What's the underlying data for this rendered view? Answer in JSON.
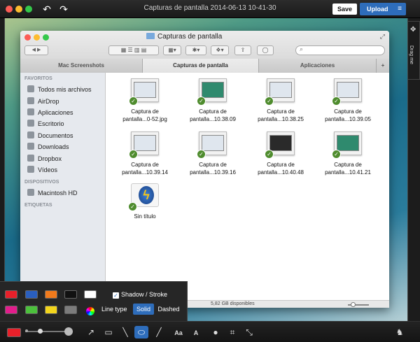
{
  "topbar": {
    "title": "Capturas de pantalla 2014-06-13 10-41-30",
    "save_label": "Save",
    "upload_label": "Upload",
    "undo_icon": "undo-icon",
    "redo_icon": "redo-icon",
    "menu_icon": "hamburger-menu-icon"
  },
  "drag_tab": {
    "label": "Drag me"
  },
  "finder": {
    "title": "Capturas de pantalla",
    "tabs": [
      {
        "label": "Mac Screenshots"
      },
      {
        "label": "Capturas de pantalla"
      },
      {
        "label": "Aplicaciones"
      },
      {
        "label": "+"
      }
    ],
    "sidebar": {
      "favorites_header": "FAVORITOS",
      "favorites": [
        {
          "label": "Todos mis archivos"
        },
        {
          "label": "AirDrop"
        },
        {
          "label": "Aplicaciones"
        },
        {
          "label": "Escritorio"
        },
        {
          "label": "Documentos"
        },
        {
          "label": "Downloads"
        },
        {
          "label": "Dropbox"
        },
        {
          "label": "Vídeos"
        }
      ],
      "devices_header": "DISPOSITIVOS",
      "devices": [
        {
          "label": "Macintosh HD"
        }
      ],
      "tags_header": "ETIQUETAS"
    },
    "files": [
      {
        "line1": "Captura de",
        "line2": "pantalla...0-52.jpg"
      },
      {
        "line1": "Captura de",
        "line2": "pantalla...10.38.09"
      },
      {
        "line1": "Captura de",
        "line2": "pantalla...10.38.25"
      },
      {
        "line1": "Captura de",
        "line2": "pantalla...10.39.05"
      },
      {
        "line1": "Captura de",
        "line2": "pantalla...10.39.14"
      },
      {
        "line1": "Captura de",
        "line2": "pantalla...10.39.16"
      },
      {
        "line1": "Captura de",
        "line2": "pantalla...10.40.48"
      },
      {
        "line1": "Captura de",
        "line2": "pantalla...10.41.21"
      },
      {
        "line1": "Sin título",
        "line2": ""
      }
    ],
    "status": "5,82 GB disponibles"
  },
  "color_panel": {
    "colors_row1": [
      "#e8202a",
      "#2a5fbf",
      "#f07a1c",
      "#111111",
      "#ffffff"
    ],
    "colors_row2": [
      "#e21d8c",
      "#4cc13c",
      "#f3d51c",
      "#7c7c7c"
    ],
    "shadow_stroke_label": "Shadow / Stroke",
    "line_type_label": "Line type",
    "solid_label": "Solid",
    "dashed_label": "Dashed"
  },
  "toolbar": {
    "current_color": "#e8202a",
    "text_tool_label": "Aa",
    "text_style_label": "A"
  }
}
